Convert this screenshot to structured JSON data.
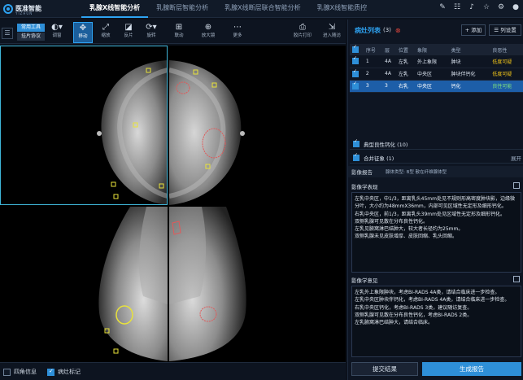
{
  "app": {
    "logo_text": "医准智能",
    "logo_sub": "YIZHUN"
  },
  "main_tabs": [
    {
      "label": "乳腺X线智能分析"
    },
    {
      "label": "乳腺断层智能分析"
    },
    {
      "label": "乳腺X线断层联合智能分析"
    },
    {
      "label": "乳腺X线智能质控"
    }
  ],
  "toolbar": {
    "common_tools_label": "常用工具",
    "protocol_label": "挂片协议",
    "tools": [
      {
        "label": "调窗"
      },
      {
        "label": "移动"
      },
      {
        "label": "缩放"
      },
      {
        "label": "反片"
      },
      {
        "label": "旋转"
      },
      {
        "label": "联动"
      },
      {
        "label": "放大镜"
      },
      {
        "label": "更多"
      },
      {
        "label": "胶片打印"
      },
      {
        "label": "进入随访"
      }
    ]
  },
  "status": {
    "corner_info_label": "四角信息",
    "lesion_mark_label": "病灶标记"
  },
  "lesion_panel": {
    "title": "病灶列表",
    "count": "(3)",
    "add_label": "+ 添加",
    "settings_label": "☰ 列设置",
    "columns": [
      "序号",
      "层",
      "位置",
      "象限",
      "类型",
      "良恶性"
    ],
    "rows": [
      {
        "index": "1",
        "layer": "4A",
        "side": "左乳",
        "quadrant": "外上象限",
        "type": "肿块",
        "risk": "低度可疑",
        "risk_color": "#f0c419"
      },
      {
        "index": "2",
        "layer": "4A",
        "side": "左乳",
        "quadrant": "中央区",
        "type": "肿块伴钙化",
        "risk": "低度可疑",
        "risk_color": "#f0c419"
      },
      {
        "index": "3",
        "layer": "3",
        "side": "右乳",
        "quadrant": "中央区",
        "type": "钙化",
        "risk": "良性可能",
        "risk_color": "#7ee07e"
      }
    ],
    "typical_calc": "典型良性钙化 (10)",
    "merged_signs": "合并征象 (1)",
    "merged_suffix": "展开"
  },
  "report": {
    "title": "影像报告",
    "gland_type": "腺体类型: B型 散在纤维腺体型",
    "findings_title": "影像学表现",
    "findings": [
      "左乳中央区，中1/3，距离乳头45mm处见不规则形高密度肿块影，边缘微分叶，大小约为48mmX36mm，内部可见区域性无定形及细形钙化。",
      "右乳中央区，前1/3，距离乳头39mm处见区域性无定形及细形钙化。",
      "双侧乳腺可见散在分布良性钙化。",
      "左乳见腋窝淋巴结肿大，较大者长径约为25mm。",
      "双侧乳腺未见皮肤增厚、皮肤回缩、乳头回缩。"
    ],
    "opinion_title": "影像学意见",
    "opinions": [
      "左乳外上象限肿块，考虑BI-RADS 4A类，请结合临床进一步检查。",
      "左乳中央区肿块伴钙化，考虑BI-RADS 4A类，请结合临床进一步检查。",
      "右乳中央区钙化，考虑BI-RADS 3类，建议随访复查。",
      "双侧乳腺可见散在分布良性钙化，考虑BI-RADS 2类。",
      "左乳腋窝淋巴结肿大，请结合临床。"
    ],
    "submit_label": "提交结果",
    "generate_label": "生成报告"
  }
}
